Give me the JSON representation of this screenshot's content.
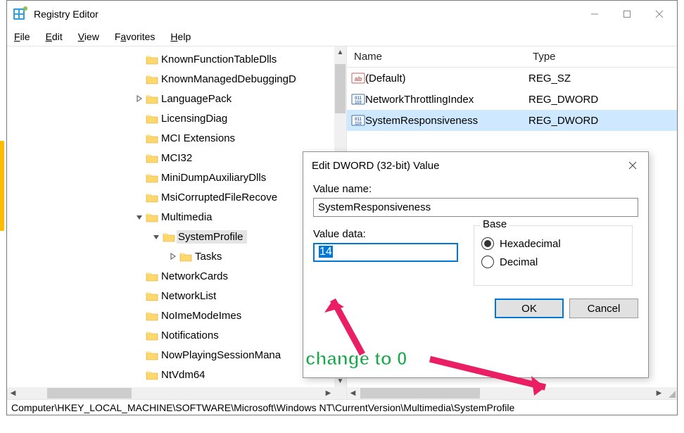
{
  "app": {
    "title": "Registry Editor"
  },
  "menu": {
    "file": "File",
    "file_u": "F",
    "edit": "Edit",
    "edit_u": "E",
    "view": "View",
    "view_u": "V",
    "fav": "Favorites",
    "fav_u": "a",
    "help": "Help",
    "help_u": "H"
  },
  "tree": [
    {
      "indent": 195,
      "chev": "",
      "label": "KnownFunctionTableDlls"
    },
    {
      "indent": 195,
      "chev": "",
      "label": "KnownManagedDebuggingD"
    },
    {
      "indent": 195,
      "chev": ">",
      "label": "LanguagePack"
    },
    {
      "indent": 195,
      "chev": "",
      "label": "LicensingDiag"
    },
    {
      "indent": 195,
      "chev": "",
      "label": "MCI Extensions"
    },
    {
      "indent": 195,
      "chev": "",
      "label": "MCI32"
    },
    {
      "indent": 195,
      "chev": "",
      "label": "MiniDumpAuxiliaryDlls"
    },
    {
      "indent": 195,
      "chev": "",
      "label": "MsiCorruptedFileRecove"
    },
    {
      "indent": 195,
      "chev": "v",
      "label": "Multimedia"
    },
    {
      "indent": 219,
      "chev": "v",
      "label": "SystemProfile",
      "sel": true
    },
    {
      "indent": 243,
      "chev": ">",
      "label": "Tasks"
    },
    {
      "indent": 195,
      "chev": "",
      "label": "NetworkCards"
    },
    {
      "indent": 195,
      "chev": "",
      "label": "NetworkList"
    },
    {
      "indent": 195,
      "chev": "",
      "label": "NoImeModeImes"
    },
    {
      "indent": 195,
      "chev": "",
      "label": "Notifications"
    },
    {
      "indent": 195,
      "chev": "",
      "label": "NowPlayingSessionMana"
    },
    {
      "indent": 195,
      "chev": "",
      "label": "NtVdm64"
    }
  ],
  "list": {
    "headers": {
      "name": "Name",
      "type": "Type"
    },
    "rows": [
      {
        "icon": "str",
        "name": "(Default)",
        "type": "REG_SZ"
      },
      {
        "icon": "bin",
        "name": "NetworkThrottlingIndex",
        "type": "REG_DWORD"
      },
      {
        "icon": "bin",
        "name": "SystemResponsiveness",
        "type": "REG_DWORD",
        "sel": true
      }
    ]
  },
  "status": "Computer\\HKEY_LOCAL_MACHINE\\SOFTWARE\\Microsoft\\Windows NT\\CurrentVersion\\Multimedia\\SystemProfile",
  "dialog": {
    "title": "Edit DWORD (32-bit) Value",
    "name_label": "Value name:",
    "name_value": "SystemResponsiveness",
    "data_label": "Value data:",
    "data_value": "14",
    "base_label": "Base",
    "hex": "Hexadecimal",
    "dec": "Decimal",
    "ok": "OK",
    "cancel": "Cancel"
  },
  "annotation": "change to 0"
}
